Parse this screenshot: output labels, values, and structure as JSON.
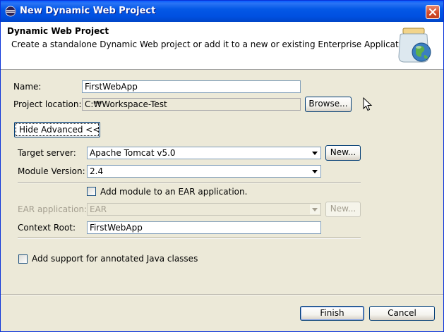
{
  "window": {
    "title": "New Dynamic Web Project"
  },
  "header": {
    "title": "Dynamic Web Project",
    "description": "Create a standalone Dynamic Web project or add it to a new or existing Enterprise Application."
  },
  "form": {
    "name_label": "Name:",
    "name_value": "FirstWebApp",
    "location_label": "Project location:",
    "location_value": "C:₩Workspace-Test",
    "browse_label": "Browse...",
    "advanced_label": "Hide Advanced <<",
    "target_server_label": "Target server:",
    "target_server_value": "Apache Tomcat v5.0",
    "new_label": "New...",
    "module_version_label": "Module Version:",
    "module_version_value": "2.4",
    "ear_checkbox_label": "Add module to an EAR application.",
    "ear_app_label": "EAR application:",
    "ear_app_value": "EAR",
    "ear_new_label": "New...",
    "context_root_label": "Context Root:",
    "context_root_value": "FirstWebApp",
    "annotated_label": "Add support for annotated Java classes"
  },
  "footer": {
    "finish_label": "Finish",
    "cancel_label": "Cancel"
  },
  "icons": {
    "title": "eclipse-icon",
    "header": "web-project-jar-icon",
    "close": "close-icon",
    "dropdown": "chevron-down-icon"
  },
  "colors": {
    "titlebar": "#0458E6",
    "dialog_bg": "#ECE9D8",
    "field_border": "#7F9DB9",
    "close_button": "#D24B2A"
  }
}
